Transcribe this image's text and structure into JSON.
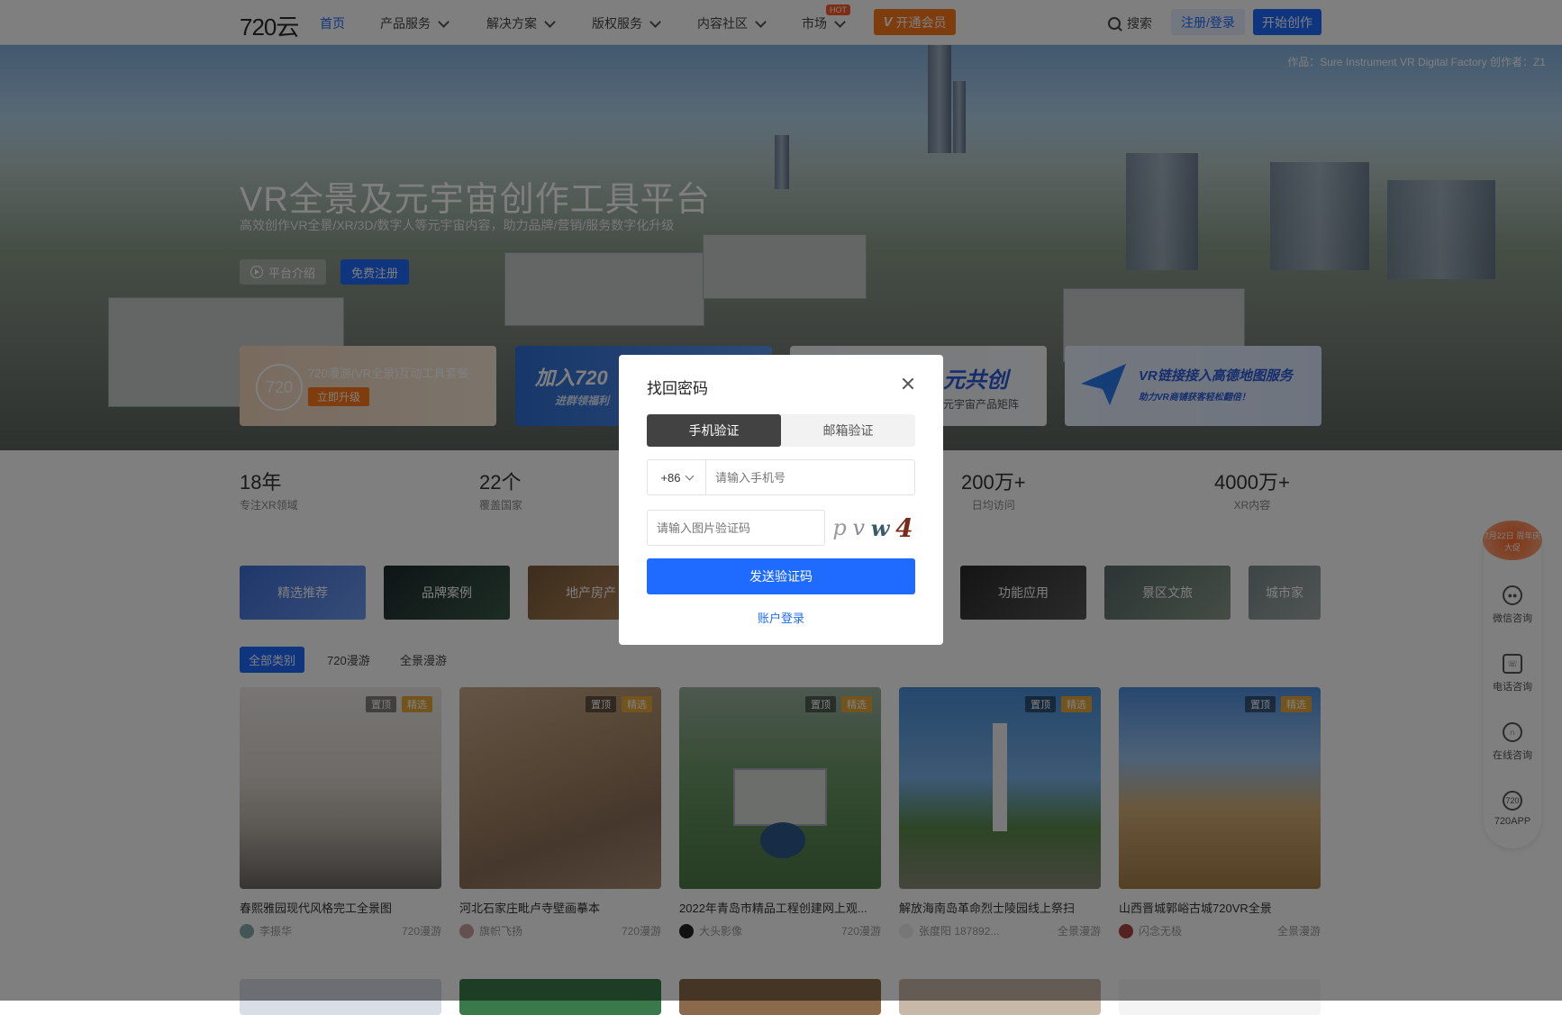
{
  "nav": {
    "logo": "720云",
    "items": [
      "首页",
      "产品服务",
      "解决方案",
      "版权服务",
      "内容社区",
      "市场"
    ],
    "hot_badge": "HOT",
    "vip_label": "开通会员",
    "search_label": "搜索",
    "login_label": "注册/登录",
    "create_label": "开始创作"
  },
  "hero": {
    "credit": "作品：Sure Instrument VR Digital Factory   创作者：Z1",
    "title": "VR全景及元宇宙创作工具平台",
    "subtitle": "高效创作VR全景/XR/3D/数字人等元宇宙内容，助力品牌/营销/服务数字化升级",
    "intro_label": "平台介绍",
    "register_label": "免费注册"
  },
  "promos": {
    "p1_logo": "720",
    "p1_text": "720漫游(VR全景)互动工具套餐",
    "p1_btn": "立即升级",
    "p2_big": "加入720",
    "p2_small": "进群领福利",
    "p3_big": "元共创",
    "p3_small": "元宇宙产品矩阵",
    "p4_big": "VR链接接入高德地图服务",
    "p4_small": "助力VR商铺获客轻松翻倍！"
  },
  "stats": [
    {
      "num": "18年",
      "label": "专注XR领域"
    },
    {
      "num": "22个",
      "label": "覆盖国家"
    },
    {
      "num": "200万+",
      "label": "日均访问"
    },
    {
      "num": "4000万+",
      "label": "XR内容"
    }
  ],
  "categories": [
    "精选推荐",
    "品牌案例",
    "地产房产",
    "功能应用",
    "景区文旅",
    "城市家"
  ],
  "subtabs": [
    "全部类别",
    "720漫游",
    "全景漫游"
  ],
  "badges": {
    "top": "置顶",
    "pick": "精选"
  },
  "cards": [
    {
      "title": "春熙雅园现代风格完工全景图",
      "author": "李振华",
      "type": "720漫游"
    },
    {
      "title": "河北石家庄毗卢寺壁画摹本",
      "author": "旗帜飞扬",
      "type": "720漫游"
    },
    {
      "title": "2022年青岛市精品工程创建网上观...",
      "author": "大头影像",
      "type": "720漫游"
    },
    {
      "title": "解放海南岛革命烈士陵园线上祭扫",
      "author": "张度阳 187892...",
      "type": "全景漫游"
    },
    {
      "title": "山西晋城郭峪古城720VR全景",
      "author": "闪念无极",
      "type": "全景漫游"
    }
  ],
  "sidebar": {
    "sale": "7月22日 周年庆大促",
    "wechat": "微信咨询",
    "phone": "电话咨询",
    "online": "在线咨询",
    "app_icon": "720",
    "app": "720APP"
  },
  "modal": {
    "title": "找回密码",
    "tab_phone": "手机验证",
    "tab_email": "邮箱验证",
    "country_code": "+86",
    "phone_placeholder": "请输入手机号",
    "captcha_placeholder": "请输入图片验证码",
    "captcha_chars": [
      "p",
      "v",
      "w",
      "4"
    ],
    "send_label": "发送验证码",
    "account_login": "账户登录"
  },
  "colors": {
    "primary": "#1f6bff",
    "vip": "#ff7a1a",
    "pick": "#e8a93a"
  }
}
